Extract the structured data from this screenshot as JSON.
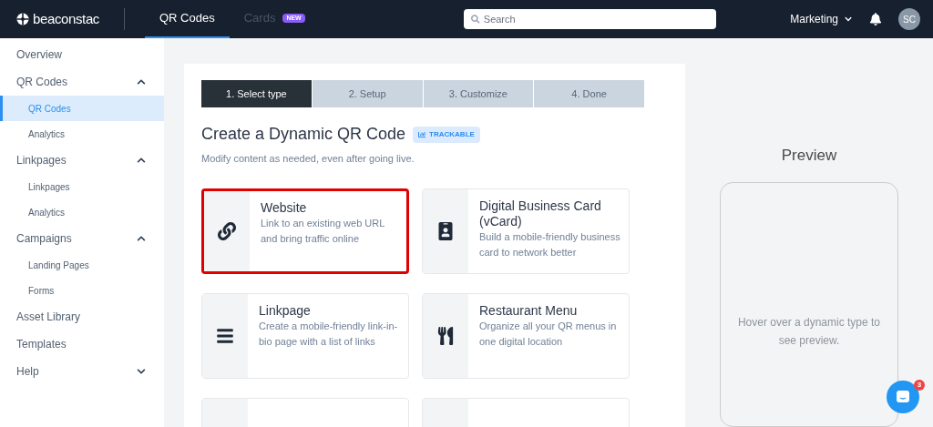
{
  "topbar": {
    "logo": "beaconstac",
    "tabs": [
      {
        "label": "QR Codes",
        "selected": true
      },
      {
        "label": "Cards",
        "selected": false,
        "badge": "NEW"
      }
    ],
    "search": {
      "placeholder": "Search"
    },
    "workspace": "Marketing",
    "avatar": "SC"
  },
  "sidebar": {
    "items": [
      {
        "label": "Overview"
      },
      {
        "label": "QR Codes",
        "expanded": true,
        "children": [
          {
            "label": "QR Codes",
            "selected": true
          },
          {
            "label": "Analytics",
            "selected": false
          }
        ]
      },
      {
        "label": "Linkpages",
        "expanded": true,
        "children": [
          {
            "label": "Linkpages",
            "selected": false
          },
          {
            "label": "Analytics",
            "selected": false
          }
        ]
      },
      {
        "label": "Campaigns",
        "expanded": true,
        "children": [
          {
            "label": "Landing Pages",
            "selected": false
          },
          {
            "label": "Forms",
            "selected": false
          }
        ]
      },
      {
        "label": "Asset Library"
      },
      {
        "label": "Templates"
      },
      {
        "label": "Help",
        "expanded": false
      }
    ]
  },
  "steps": [
    {
      "label": "1. Select type",
      "selected": true
    },
    {
      "label": "2. Setup",
      "selected": false
    },
    {
      "label": "3. Customize",
      "selected": false
    },
    {
      "label": "4. Done",
      "selected": false
    }
  ],
  "heading": "Create a Dynamic QR Code",
  "badge": "TRACKABLE",
  "subtitle": "Modify content as needed, even after going live.",
  "cards": [
    {
      "kind": "link",
      "title": "Website",
      "description": "Link to an existing web URL and bring traffic online",
      "highlighted": true
    },
    {
      "kind": "vcard",
      "title": "Digital Business Card (vCard)",
      "description": "Build a mobile-friendly business card to network better",
      "highlighted": false
    },
    {
      "kind": "list",
      "title": "Linkpage",
      "description": "Create a mobile-friendly link-in-bio page with a list of links",
      "highlighted": false
    },
    {
      "kind": "menu",
      "title": "Restaurant Menu",
      "description": "Organize all your QR menus in one digital location",
      "highlighted": false
    },
    {
      "kind": "empty",
      "highlighted": false
    },
    {
      "kind": "empty",
      "highlighted": false
    }
  ],
  "preview": {
    "title": "Preview",
    "hint": "Hover over a dynamic type to see preview."
  },
  "chat": {
    "count": "3"
  }
}
